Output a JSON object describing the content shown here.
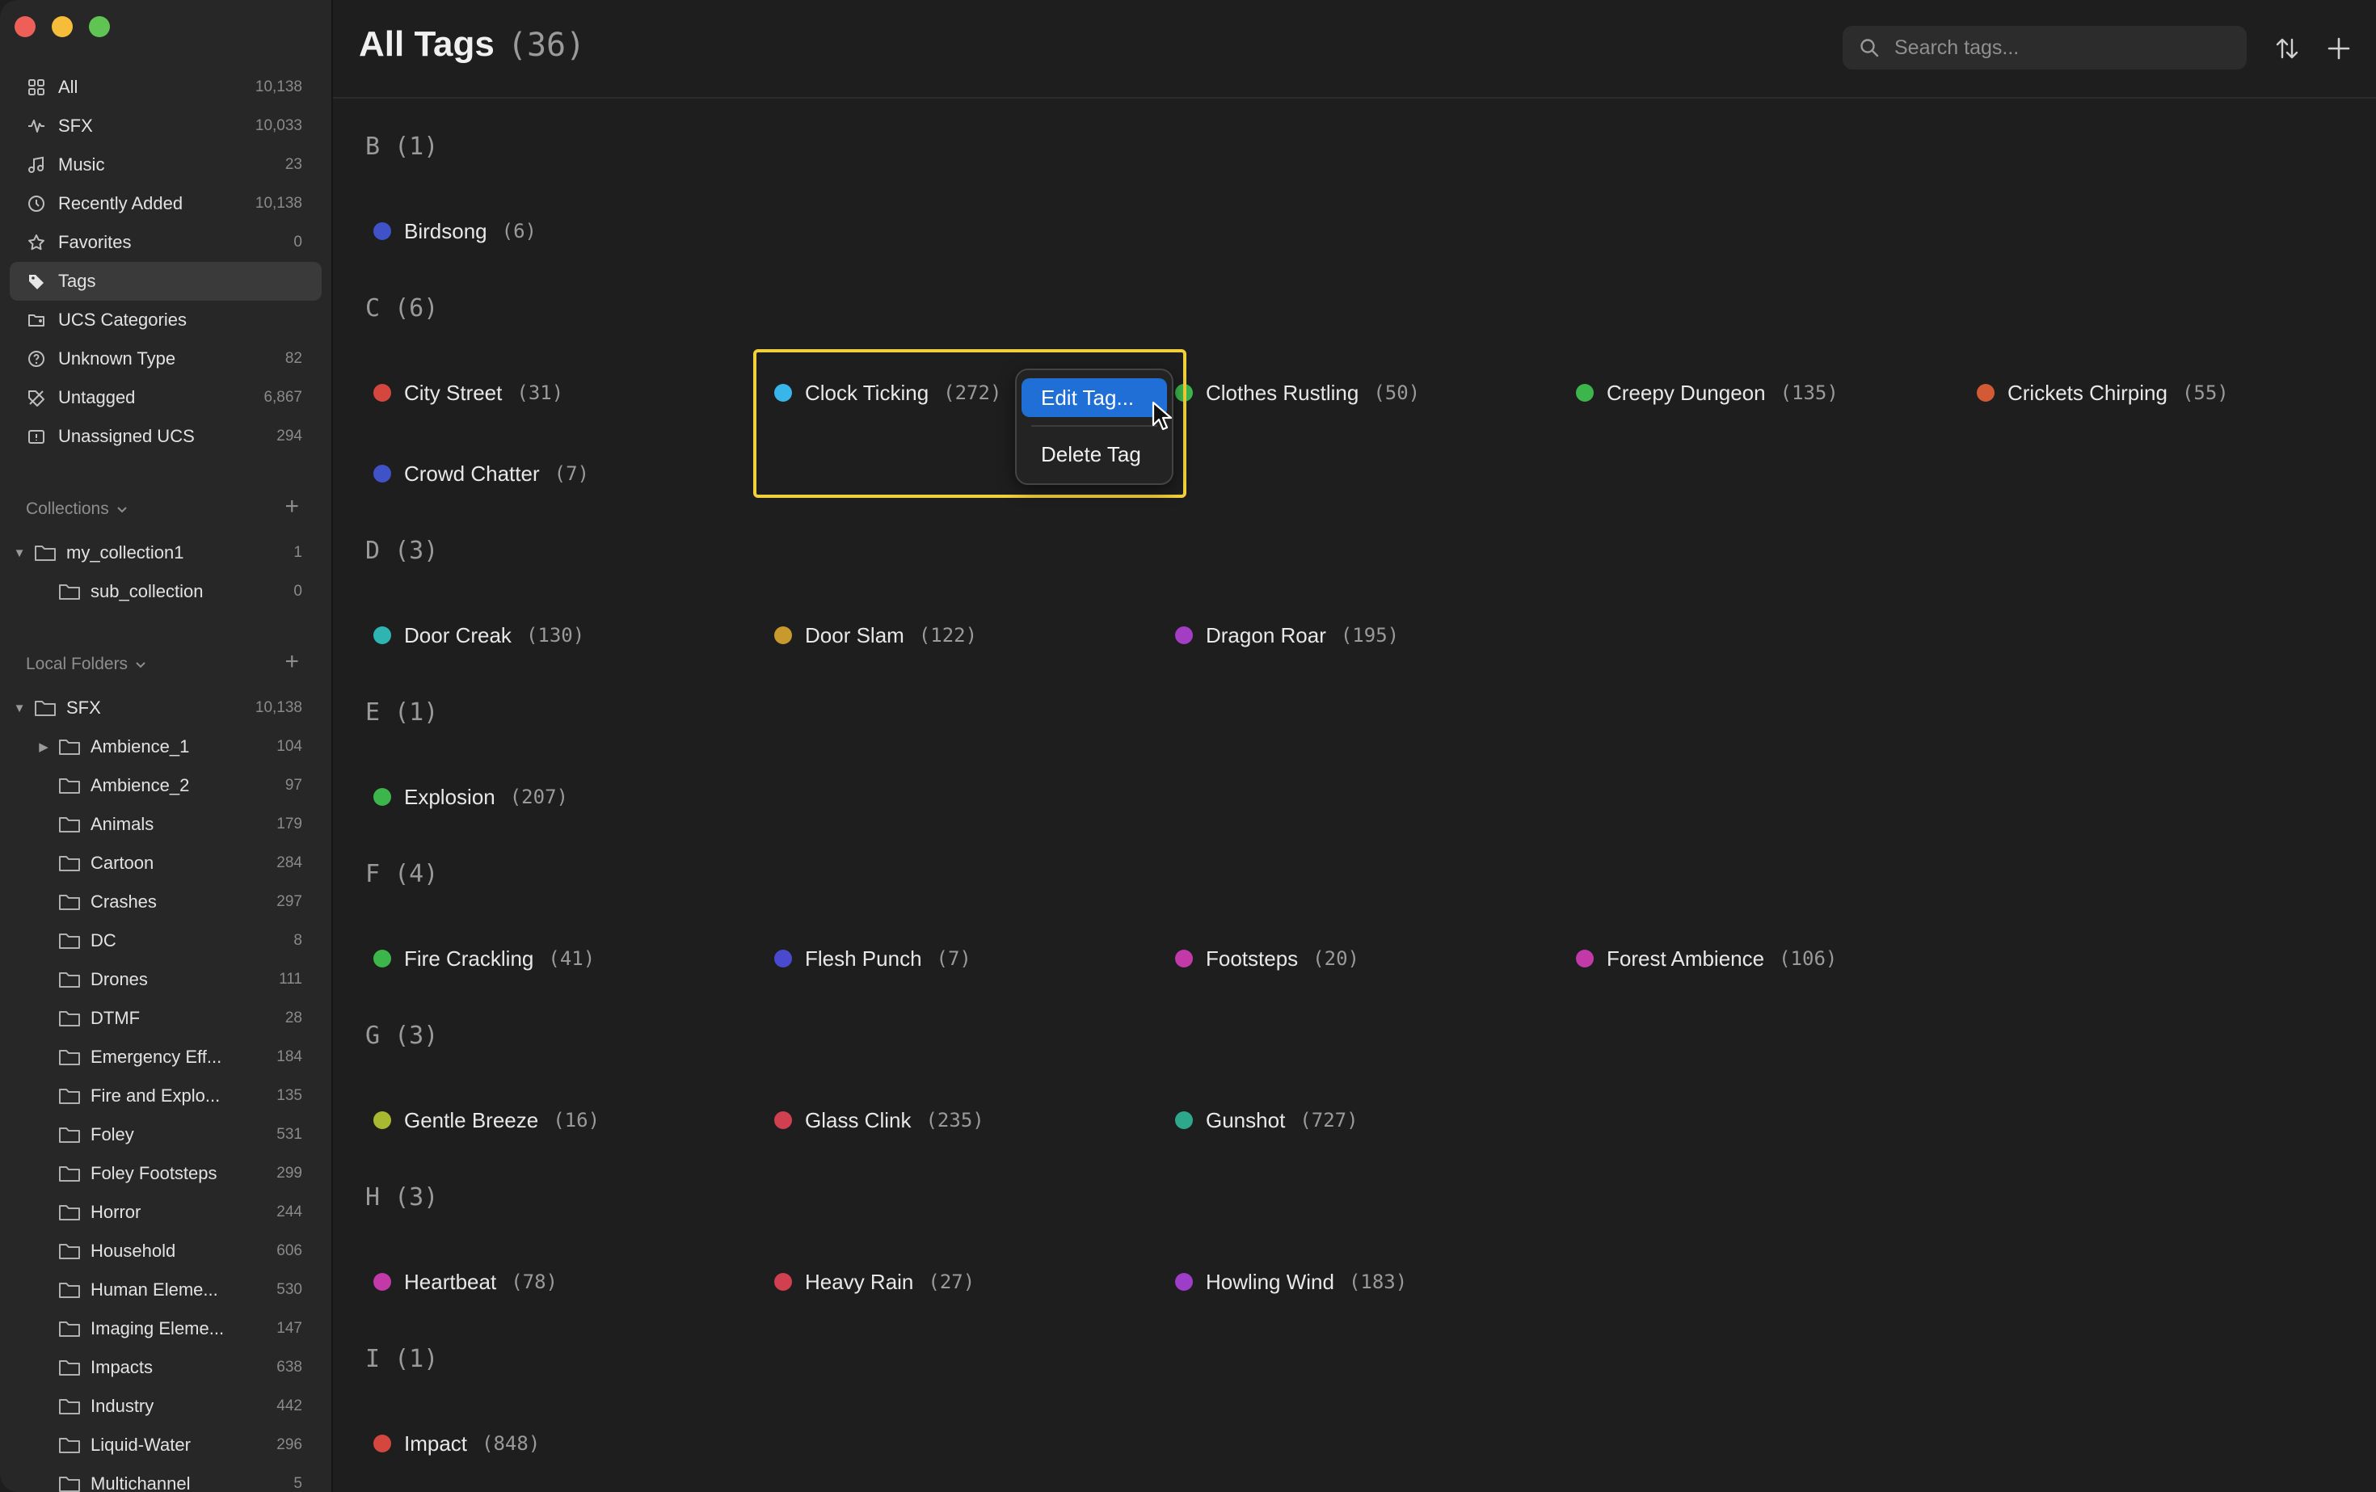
{
  "sidebar": {
    "nav": [
      {
        "label": "All",
        "count": "10,138",
        "icon": "grid-icon"
      },
      {
        "label": "SFX",
        "count": "10,033",
        "icon": "waveform-icon"
      },
      {
        "label": "Music",
        "count": "23",
        "icon": "music-note-icon"
      },
      {
        "label": "Recently Added",
        "count": "10,138",
        "icon": "clock-icon"
      },
      {
        "label": "Favorites",
        "count": "0",
        "icon": "star-icon"
      },
      {
        "label": "Tags",
        "count": "",
        "icon": "tag-icon",
        "selected": true
      },
      {
        "label": "UCS Categories",
        "count": "",
        "icon": "folder-tag-icon"
      },
      {
        "label": "Unknown Type",
        "count": "82",
        "icon": "question-icon"
      },
      {
        "label": "Untagged",
        "count": "6,867",
        "icon": "tag-off-icon"
      },
      {
        "label": "Unassigned UCS",
        "count": "294",
        "icon": "unassigned-icon"
      }
    ],
    "collections": {
      "header": "Collections",
      "items": [
        {
          "label": "my_collection1",
          "count": "1",
          "level": 0,
          "expanded": true
        },
        {
          "label": "sub_collection",
          "count": "0",
          "level": 1
        }
      ]
    },
    "local_folders": {
      "header": "Local Folders",
      "items": [
        {
          "label": "SFX",
          "count": "10,138",
          "level": 0,
          "expanded": true
        },
        {
          "label": "Ambience_1",
          "count": "104",
          "level": 1,
          "collapsed": true
        },
        {
          "label": "Ambience_2",
          "count": "97",
          "level": 1
        },
        {
          "label": "Animals",
          "count": "179",
          "level": 1
        },
        {
          "label": "Cartoon",
          "count": "284",
          "level": 1
        },
        {
          "label": "Crashes",
          "count": "297",
          "level": 1
        },
        {
          "label": "DC",
          "count": "8",
          "level": 1
        },
        {
          "label": "Drones",
          "count": "111",
          "level": 1
        },
        {
          "label": "DTMF",
          "count": "28",
          "level": 1
        },
        {
          "label": "Emergency Eff...",
          "count": "184",
          "level": 1
        },
        {
          "label": "Fire and Explo...",
          "count": "135",
          "level": 1
        },
        {
          "label": "Foley",
          "count": "531",
          "level": 1
        },
        {
          "label": "Foley Footsteps",
          "count": "299",
          "level": 1
        },
        {
          "label": "Horror",
          "count": "244",
          "level": 1
        },
        {
          "label": "Household",
          "count": "606",
          "level": 1
        },
        {
          "label": "Human Eleme...",
          "count": "530",
          "level": 1
        },
        {
          "label": "Imaging Eleme...",
          "count": "147",
          "level": 1
        },
        {
          "label": "Impacts",
          "count": "638",
          "level": 1
        },
        {
          "label": "Industry",
          "count": "442",
          "level": 1
        },
        {
          "label": "Liquid-Water",
          "count": "296",
          "level": 1
        },
        {
          "label": "Multichannel",
          "count": "5",
          "level": 1
        }
      ]
    }
  },
  "header": {
    "title": "All Tags",
    "count": "(36)",
    "search_placeholder": "Search tags..."
  },
  "groups": [
    {
      "letter": "B",
      "count": "(1)",
      "tags": [
        {
          "name": "Birdsong",
          "count": "(6)",
          "color": "#3f52c8"
        }
      ]
    },
    {
      "letter": "C",
      "count": "(6)",
      "tags": [
        {
          "name": "City Street",
          "count": "(31)",
          "color": "#d5463f"
        },
        {
          "name": "Clock Ticking",
          "count": "(272)",
          "color": "#38b6ea"
        },
        {
          "name": "Clothes Rustling",
          "count": "(50)",
          "color": "#3cb54a"
        },
        {
          "name": "Creepy Dungeon",
          "count": "(135)",
          "color": "#3cb54a"
        },
        {
          "name": "Crickets Chirping",
          "count": "(55)",
          "color": "#d25a34"
        },
        {
          "name": "Crowd Chatter",
          "count": "(7)",
          "color": "#3f52c8"
        }
      ]
    },
    {
      "letter": "D",
      "count": "(3)",
      "tags": [
        {
          "name": "Door Creak",
          "count": "(130)",
          "color": "#2eb5b2"
        },
        {
          "name": "Door Slam",
          "count": "(122)",
          "color": "#c89a2e"
        },
        {
          "name": "Dragon Roar",
          "count": "(195)",
          "color": "#a23dc4"
        }
      ]
    },
    {
      "letter": "E",
      "count": "(1)",
      "tags": [
        {
          "name": "Explosion",
          "count": "(207)",
          "color": "#3cb54a"
        }
      ]
    },
    {
      "letter": "F",
      "count": "(4)",
      "tags": [
        {
          "name": "Fire Crackling",
          "count": "(41)",
          "color": "#3cb54a"
        },
        {
          "name": "Flesh Punch",
          "count": "(7)",
          "color": "#4a4ad0"
        },
        {
          "name": "Footsteps",
          "count": "(20)",
          "color": "#c23aa8"
        },
        {
          "name": "Forest Ambience",
          "count": "(106)",
          "color": "#c23aa8"
        }
      ]
    },
    {
      "letter": "G",
      "count": "(3)",
      "tags": [
        {
          "name": "Gentle Breeze",
          "count": "(16)",
          "color": "#a8b830"
        },
        {
          "name": "Glass Clink",
          "count": "(235)",
          "color": "#d04050"
        },
        {
          "name": "Gunshot",
          "count": "(727)",
          "color": "#2ea88c"
        }
      ]
    },
    {
      "letter": "H",
      "count": "(3)",
      "tags": [
        {
          "name": "Heartbeat",
          "count": "(78)",
          "color": "#c23aa8"
        },
        {
          "name": "Heavy Rain",
          "count": "(27)",
          "color": "#d04050"
        },
        {
          "name": "Howling Wind",
          "count": "(183)",
          "color": "#9e3ec8"
        }
      ]
    },
    {
      "letter": "I",
      "count": "(1)",
      "tags": [
        {
          "name": "Impact",
          "count": "(848)",
          "color": "#d5463f"
        }
      ]
    }
  ],
  "context_menu": {
    "items": [
      {
        "label": "Edit Tag...",
        "active": true
      },
      {
        "label": "Delete Tag",
        "active": false
      }
    ]
  }
}
